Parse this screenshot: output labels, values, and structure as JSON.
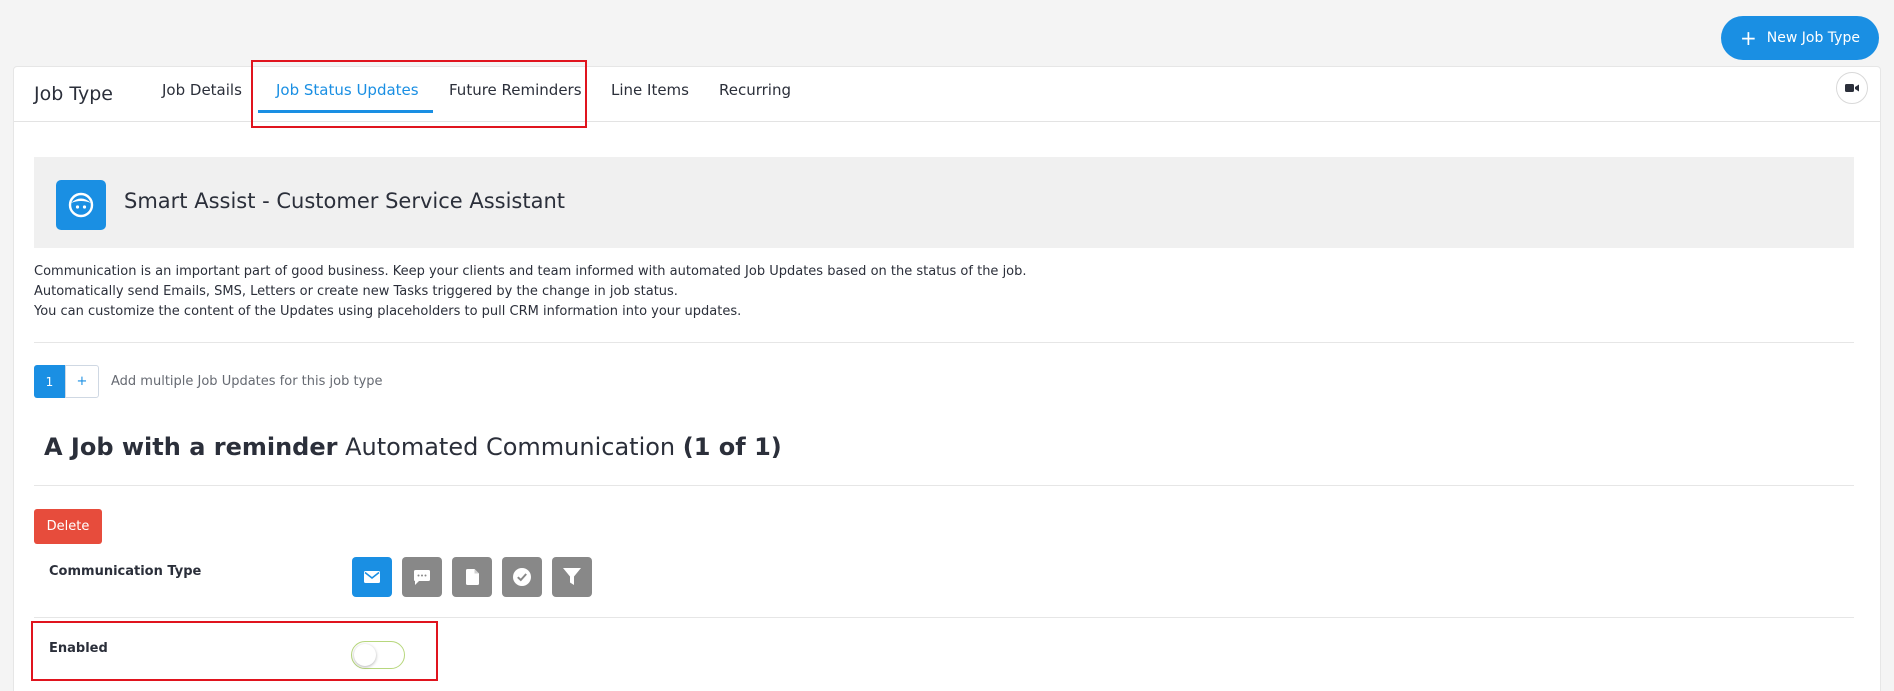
{
  "header": {
    "new_button_label": "New Job Type"
  },
  "card": {
    "title": "Job Type"
  },
  "tabs": [
    {
      "label": "Job Details"
    },
    {
      "label": "Job Status Updates",
      "active": true
    },
    {
      "label": "Future Reminders"
    },
    {
      "label": "Line Items"
    },
    {
      "label": "Recurring"
    }
  ],
  "assist": {
    "title": "Smart Assist - Customer Service Assistant"
  },
  "description": [
    "Communication is an important part of good business. Keep your clients and team informed with automated Job Updates based on the status of the job.",
    "Automatically send Emails, SMS, Letters or create new Tasks triggered by the change in job status.",
    "You can customize the content of the Updates using placeholders to pull CRM information into your updates."
  ],
  "pager": {
    "current": "1",
    "add": "+",
    "hint": "Add multiple Job Updates for this job type"
  },
  "section": {
    "name": "A Job with a reminder",
    "middle": "Automated Communication",
    "count": "(1 of 1)"
  },
  "delete_label": "Delete",
  "communication": {
    "label": "Communication Type",
    "types": [
      "email-icon",
      "sms-icon",
      "letter-icon",
      "task-icon",
      "filter-icon"
    ],
    "selected": "email-icon"
  },
  "enabled": {
    "label": "Enabled",
    "value": false
  },
  "colors": {
    "accent": "#1a8fe3",
    "danger": "#e74c3c",
    "highlight": "#e0141e",
    "inactive_icon": "#888888"
  }
}
